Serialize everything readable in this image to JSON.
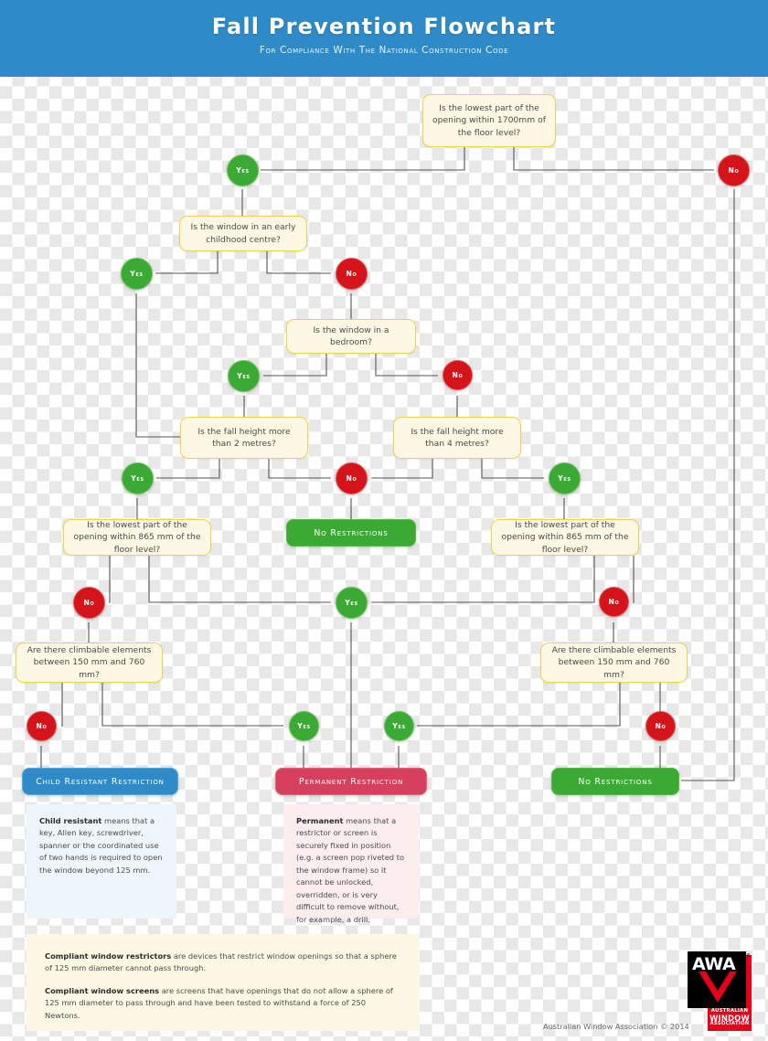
{
  "header": {
    "title": "Fall Prevention Flowchart",
    "subtitle": "For Compliance With The National Construction Code"
  },
  "nodes": {
    "q1": "Is the lowest part of the opening within 1700mm of the floor level?",
    "q2": "Is the window in an early childhood centre?",
    "q3": "Is the window in a bedroom?",
    "q4": "Is the fall height more than 2 metres?",
    "q5": "Is the fall height more than 4 metres?",
    "q6": "Is the lowest part of the opening within 865 mm of the floor level?",
    "q7": "Is the lowest part of the opening within 865 mm of the floor level?",
    "q8": "Are there climbable elements between 150 mm and 760 mm?",
    "q9": "Are there climbable elements between 150 mm and 760 mm?"
  },
  "labels": {
    "yes": "Yes",
    "no": "No"
  },
  "outcomes": {
    "no_restrictions_mid": "No Restrictions",
    "no_restrictions_right": "No Restrictions",
    "child_resistant": "Child Resistant Restriction",
    "permanent": "Permanent Restriction"
  },
  "definitions": {
    "child_resistant": {
      "term": "Child resistant",
      "body": " means that a key, Allen key, screwdriver, spanner or the coordinated use of two hands is required to open the window beyond 125 mm."
    },
    "permanent": {
      "term": "Permanent",
      "body": " means that a restrictor or screen is securely fixed in position (e.g. a screen pop riveted to the window frame) so it cannot be unlocked, overridden, or is very difficult to remove without, for example, a drill."
    }
  },
  "footnote": {
    "restrictors_term": "Compliant window restrictors",
    "restrictors_body": " are devices that restrict window openings so that a sphere of 125 mm diameter cannot pass through.",
    "screens_term": "Compliant window screens",
    "screens_body": " are screens that have openings that do not allow a sphere of 125 mm diameter to pass through and have been tested to withstand a force of 250 Newtons."
  },
  "logo": {
    "mark": "AWA",
    "registered": "®",
    "line1": "AUSTRALIAN",
    "line2": "WINDOW",
    "line3": "ASSOCIATION"
  },
  "copyright": "Australian Window Association © 2014",
  "colors": {
    "header_blue": "#2e8bc8",
    "yes_green": "#3aaa35",
    "no_red": "#d4131a",
    "question_fill": "#fdf8e3",
    "question_border": "#f2d14e",
    "permanent_red": "#d6405d",
    "child_blue": "#2e8bc8",
    "wire": "#555555"
  }
}
